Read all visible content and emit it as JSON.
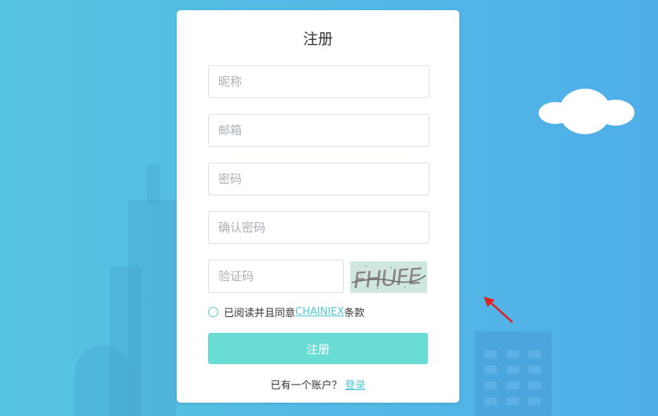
{
  "form": {
    "title": "注册",
    "fields": {
      "nickname_placeholder": "昵称",
      "email_placeholder": "邮箱",
      "password_placeholder": "密码",
      "confirm_password_placeholder": "确认密码",
      "captcha_placeholder": "验证码"
    },
    "captcha_text": "FHUFE",
    "agree_prefix": "已阅读并且同意",
    "agree_link": "CHAINIEX",
    "agree_suffix": "条款",
    "submit_label": "注册",
    "login_prompt": "已有一个账户？",
    "login_link": "登录"
  },
  "colors": {
    "accent": "#69ddd4",
    "link": "#4fc8d6",
    "background": "#53b8e6",
    "arrow": "#e0201c"
  },
  "icons": [
    "cloud-icon",
    "red-arrow-icon"
  ]
}
